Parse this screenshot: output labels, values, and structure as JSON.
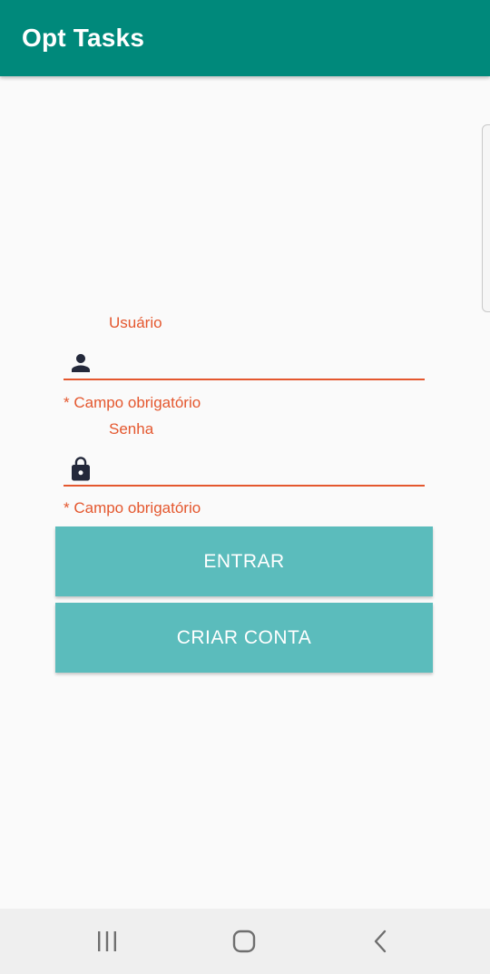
{
  "app_bar": {
    "title": "Opt Tasks"
  },
  "colors": {
    "primary": "#00897b",
    "accent_error": "#e4572e",
    "button": "#5bbcbc"
  },
  "login_form": {
    "username": {
      "label": "Usuário",
      "value": "",
      "icon": "person-icon",
      "helper": "* Campo obrigatório"
    },
    "password": {
      "label": "Senha",
      "value": "",
      "icon": "lock-icon",
      "helper": "* Campo obrigatório"
    },
    "login_button": "ENTRAR",
    "create_account_button": "CRIAR CONTA"
  },
  "nav_bar": {
    "items": [
      "recents-icon",
      "home-icon",
      "back-icon"
    ]
  }
}
